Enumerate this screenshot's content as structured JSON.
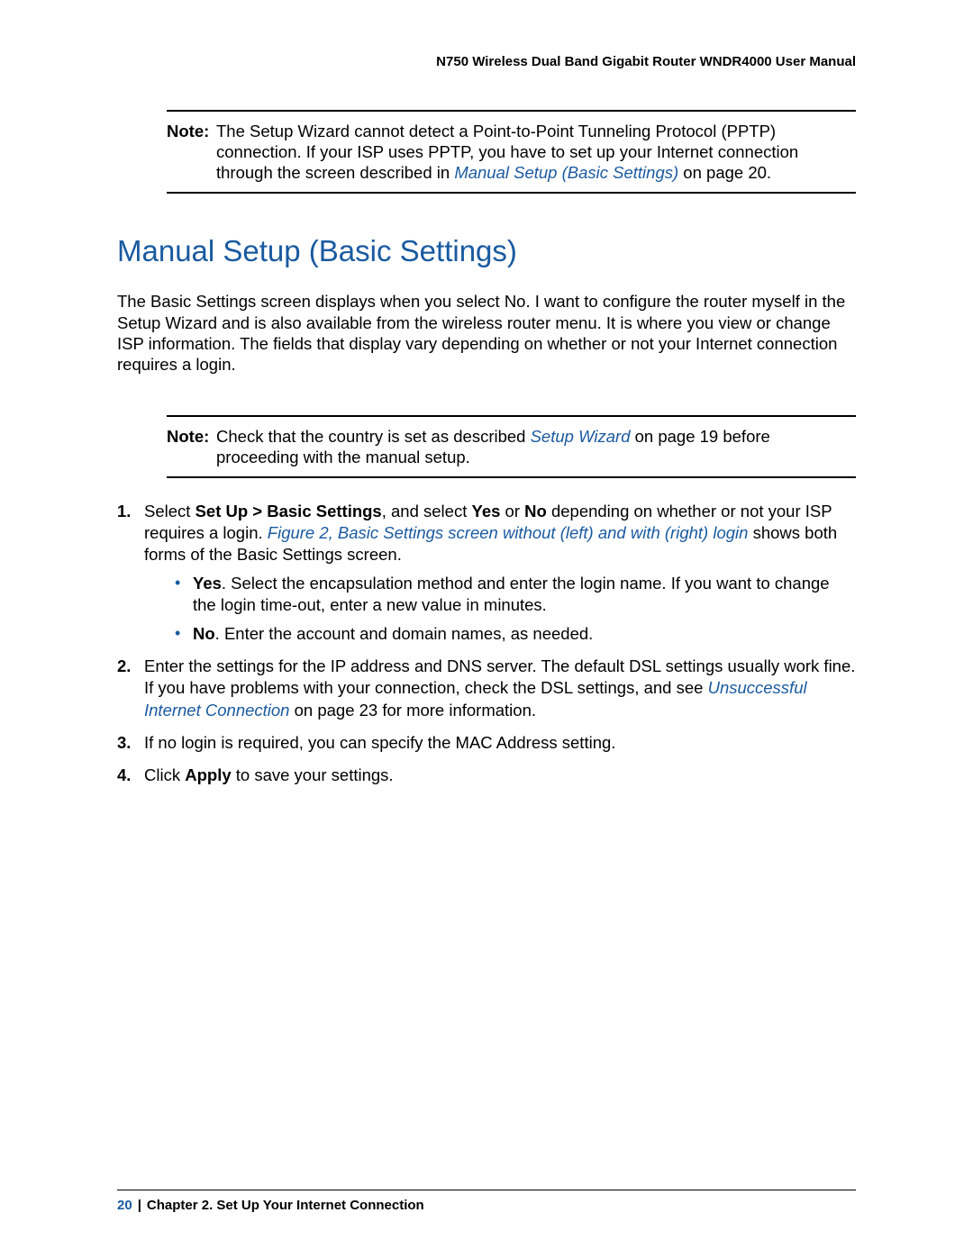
{
  "header": {
    "title": "N750 Wireless Dual Band Gigabit Router WNDR4000 User Manual"
  },
  "note1": {
    "label": "Note:",
    "t1": "The Setup Wizard cannot detect a Point-to-Point Tunneling Protocol (PPTP) connection. If your ISP uses PPTP, you have to set up your Internet connection through the screen described in ",
    "link": "Manual Setup (Basic Settings)",
    "t2": " on page 20."
  },
  "section": {
    "title": "Manual Setup (Basic Settings)",
    "para1": "The Basic Settings screen displays when you select No. I want to configure the router myself in the Setup Wizard and is also available from the wireless router menu. It is where you view or change ISP information. The fields that display vary depending on whether or not your Internet connection requires a login."
  },
  "note2": {
    "label": "Note:",
    "t1": "Check that the country is set as described ",
    "link": "Setup Wizard",
    "t2": " on page 19 before proceeding with the manual setup."
  },
  "steps": {
    "s1": {
      "a": "Select ",
      "b1": "Set Up > Basic Settings",
      "c": ", and select ",
      "b2": "Yes",
      "d": " or ",
      "b3": "No",
      "e": " depending on whether or not your ISP requires a login. ",
      "link": "Figure 2, Basic Settings screen without (left) and with (right) login",
      "f": " shows both forms of the Basic Settings screen.",
      "yes_b": "Yes",
      "yes_t": ". Select the encapsulation method and enter the login name. If you want to change the login time-out, enter a new value in minutes.",
      "no_b": "No",
      "no_t": ". Enter the account and domain names, as needed."
    },
    "s2": {
      "a": "Enter the settings for the IP address and DNS server. The default DSL settings usually work fine. If you have problems with your connection, check the DSL settings, and see ",
      "link": "Unsuccessful Internet Connection",
      "b": " on page 23 for more information."
    },
    "s3": "If no login is required, you can specify the MAC Address setting.",
    "s4": {
      "a": "Click ",
      "b": "Apply",
      "c": " to save your settings."
    }
  },
  "footer": {
    "page": "20",
    "chapter": "Chapter 2.  Set Up Your Internet Connection"
  }
}
